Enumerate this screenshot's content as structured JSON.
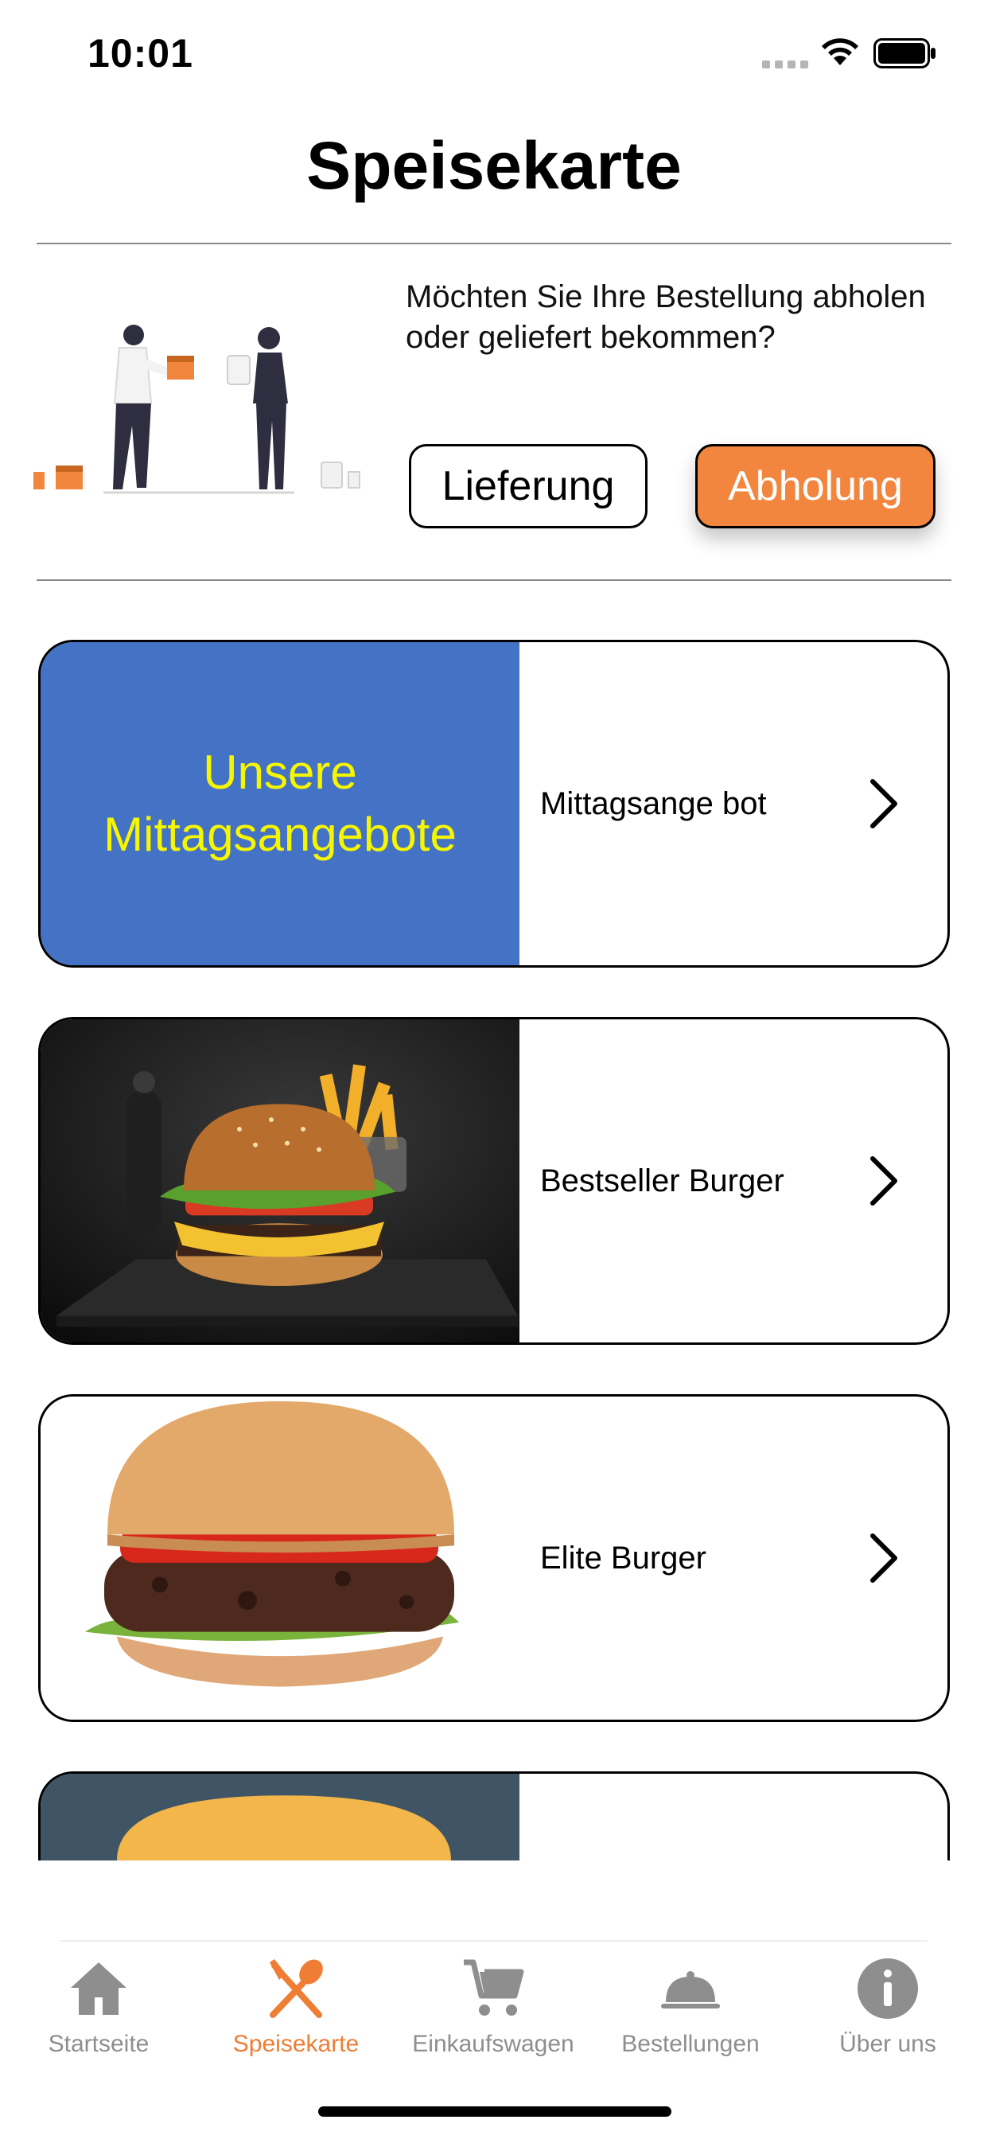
{
  "status_bar": {
    "time": "10:01"
  },
  "header": {
    "title": "Speisekarte"
  },
  "delivery": {
    "question": "Möchten Sie Ihre Bestellung abholen oder geliefert bekommen?",
    "options": [
      {
        "label": "Lieferung",
        "selected": false
      },
      {
        "label": "Abholung",
        "selected": true
      }
    ]
  },
  "categories": [
    {
      "label": "Mittagsange bot",
      "banner_text": "Unsere Mittagsangebote",
      "banner_color": "#4472c4",
      "banner_text_color": "#f6f600"
    },
    {
      "label": "Bestseller Burger"
    },
    {
      "label": "Elite Burger"
    },
    {
      "label": ""
    }
  ],
  "tabbar": {
    "active_color": "#ef7d34",
    "inactive_color": "#8e8e8e",
    "tabs": [
      {
        "label": "Startseite",
        "icon": "home-icon",
        "active": false
      },
      {
        "label": "Speisekarte",
        "icon": "cutlery-icon",
        "active": true
      },
      {
        "label": "Einkaufswagen",
        "icon": "cart-icon",
        "active": false
      },
      {
        "label": "Bestellungen",
        "icon": "cloche-icon",
        "active": false
      },
      {
        "label": "Über uns",
        "icon": "info-icon",
        "active": false
      }
    ]
  },
  "colors": {
    "accent": "#f2863f"
  }
}
